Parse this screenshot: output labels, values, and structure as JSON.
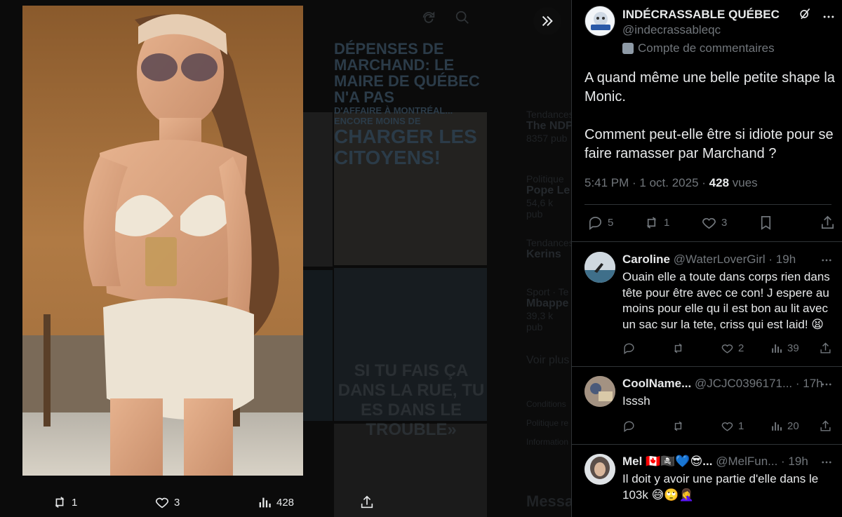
{
  "background": {
    "headline_top": "DÉPENSES DE MARCHAND:",
    "headline_mid": "LE MAIRE DE QUÉBEC N'A PAS",
    "headline_small": "D'AFFAIRE À MONTRÉAL... ENCORE MOINS DE",
    "headline_big": "CHARGER LES CITOYENS!",
    "quote": "SI TU FAIS ÇA DANS LA RUE, TU ES DANS LE TROUBLE»",
    "trends": [
      {
        "category": "Tendances",
        "name": "The NDP",
        "count": "8357 pub"
      },
      {
        "category": "Politique",
        "name": "Pope Le",
        "count": "54,6 k pub"
      },
      {
        "category": "Tendances",
        "name": "Kerins",
        "count": ""
      },
      {
        "category": "Sport · Te",
        "name": "Mbappe",
        "count": "39,3 k pub"
      }
    ],
    "see_more": "Voir plus",
    "footer_links": [
      "Conditions",
      "Politique re",
      "Information"
    ],
    "messages": "Messa"
  },
  "media_actions": {
    "reposts": "1",
    "likes": "3",
    "views": "428"
  },
  "post": {
    "author_name": "INDÉCRASSABLE QUÉBEC",
    "author_handle": "@indecrassableqc",
    "badge": "Compte de commentaires",
    "text": "A quand même une belle petite shape la Monic.\n\nComment peut-elle être si idiote pour se faire ramasser par Marchand ?",
    "time": "5:41 PM · 1 oct. 2025 · ",
    "views_count": "428",
    "views_label": " vues",
    "replies": "5",
    "reposts": "1",
    "likes": "3"
  },
  "replies": [
    {
      "name": "Caroline",
      "handle": "@WaterLoverGirl · 19h",
      "text": "Ouain elle a toute dans corps rien dans tête pour être avec ce con! J espere au moins pour elle qu il est bon au lit avec un sac sur la tete, criss qui est laid! 😫",
      "replies": "",
      "reposts": "",
      "likes": "2",
      "views": "39"
    },
    {
      "name": "CoolName...",
      "handle": "@JCJC0396171... · 17h",
      "text": "Isssh",
      "replies": "",
      "reposts": "",
      "likes": "1",
      "views": "20"
    },
    {
      "name": "Mel 🇨🇦🏴‍☠️💙😎...",
      "handle": "@MelFun... · 19h",
      "text": "Il doit y avoir une partie d'elle dans le 103k 😅🙄🤦‍♀️",
      "replies": "",
      "reposts": "",
      "likes": "",
      "views": ""
    }
  ],
  "colors": {
    "background": "#000000",
    "text": "#e7e9ea",
    "muted": "#71767b",
    "border": "#2f3336"
  }
}
